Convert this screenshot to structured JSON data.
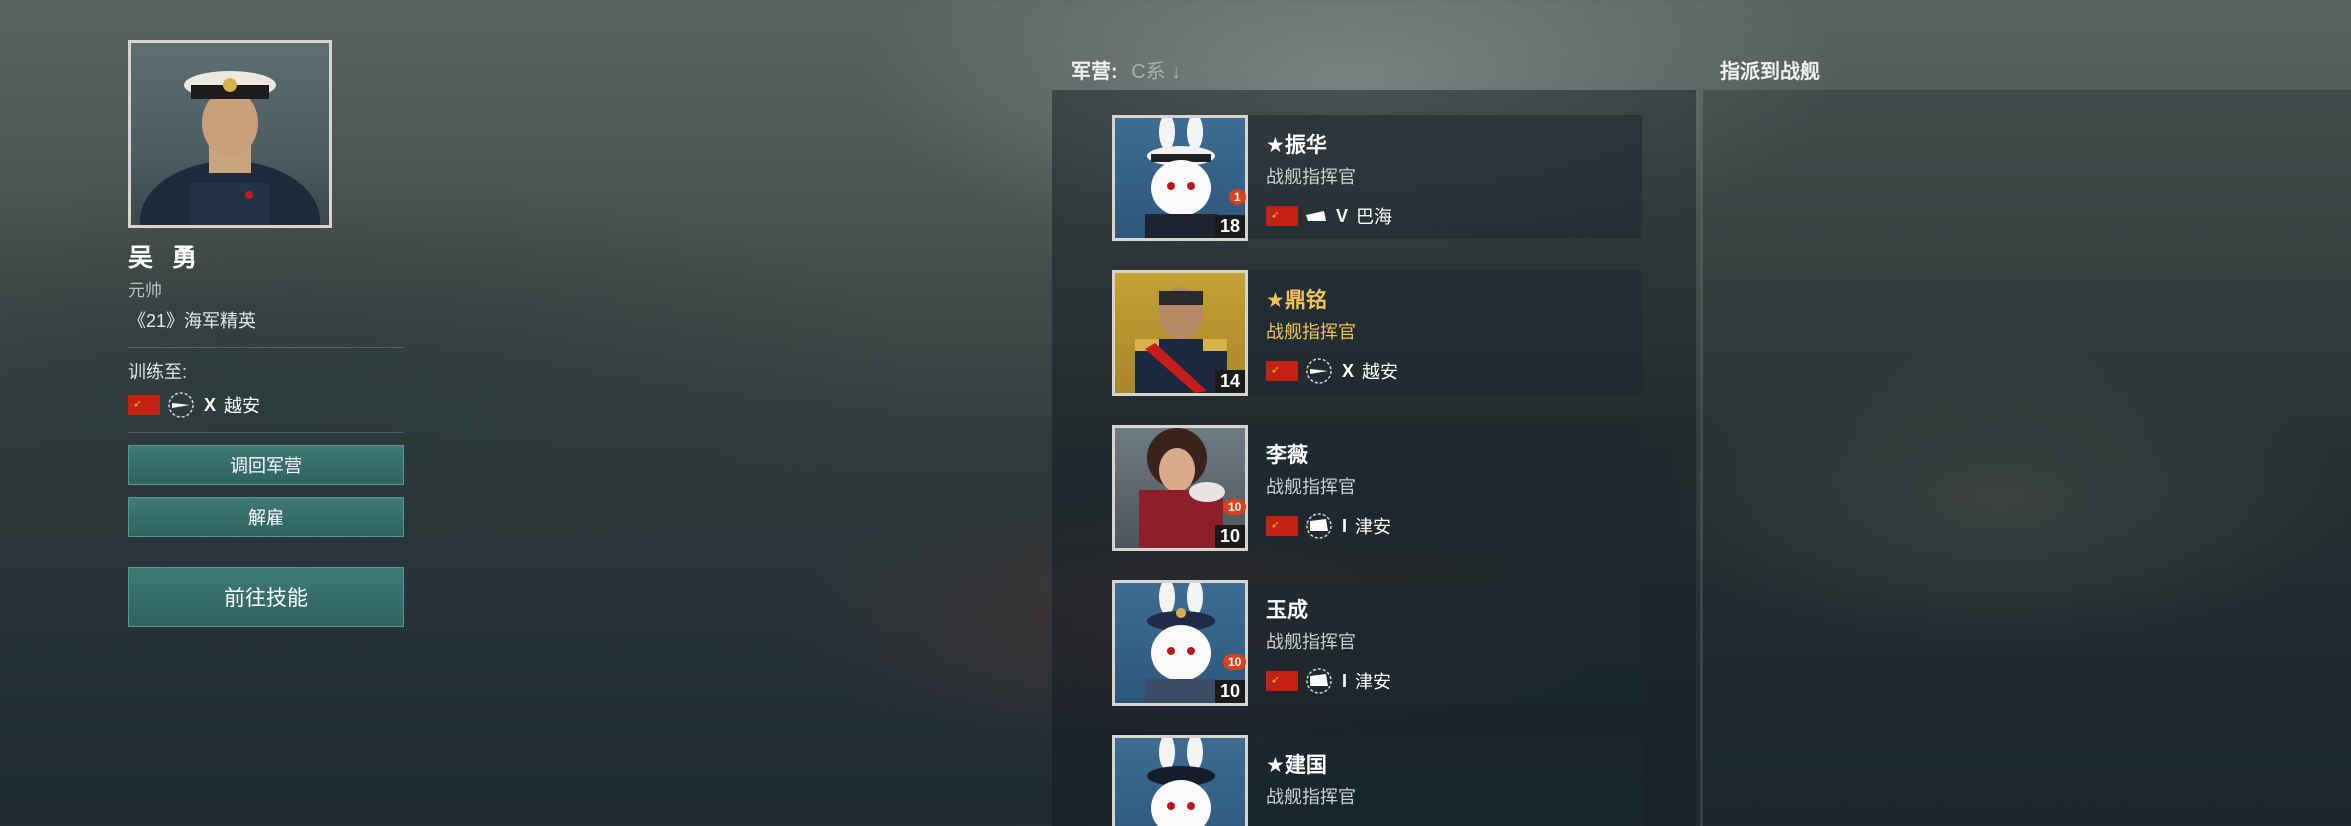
{
  "commander": {
    "name": "吴 勇",
    "rank": "元帅",
    "elite": "《21》海军精英",
    "trained_label": "训练至:",
    "trained_tier": "X",
    "trained_ship": "越安",
    "buttons": {
      "recall": "调回军营",
      "dismiss": "解雇",
      "skills": "前往技能"
    }
  },
  "barracks": {
    "label": "军营:",
    "filter": "C系 ↓"
  },
  "assign": {
    "label": "指派到战舰"
  },
  "cards": [
    {
      "name": "★振华",
      "role": "战舰指挥官",
      "level": "18",
      "badge": "1",
      "tier": "V",
      "ship": "巴海"
    },
    {
      "name": "★鼎铭",
      "role": "战舰指挥官",
      "level": "14",
      "tier": "X",
      "ship": "越安"
    },
    {
      "name": "李薇",
      "role": "战舰指挥官",
      "level": "10",
      "badge": "10",
      "tier": "I",
      "ship": "津安"
    },
    {
      "name": "玉成",
      "role": "战舰指挥官",
      "level": "10",
      "badge": "10",
      "tier": "I",
      "ship": "津安"
    },
    {
      "name": "★建国",
      "role": "战舰指挥官"
    }
  ]
}
